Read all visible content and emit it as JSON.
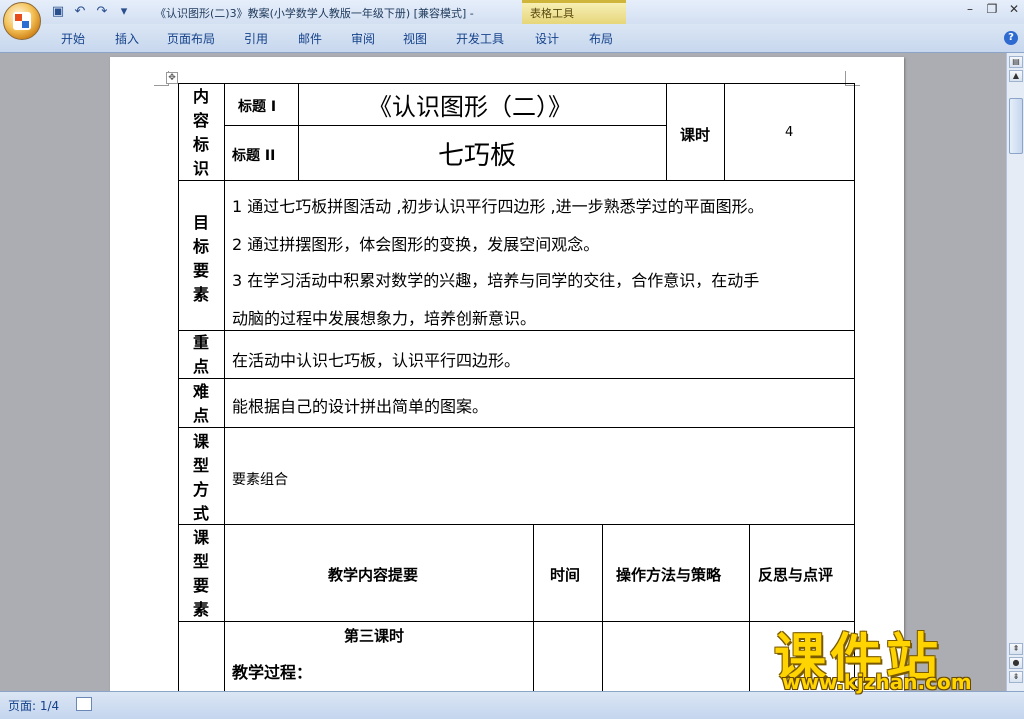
{
  "window": {
    "title": "《认识图形(二)3》教案(小学数学人教版一年级下册) [兼容模式] -",
    "context_tab_group": "表格工具",
    "min_icon": "minimize-icon",
    "restore_icon": "restore-icon",
    "close_icon": "close-icon"
  },
  "ribbon": {
    "tabs": [
      "开始",
      "插入",
      "页面布局",
      "引用",
      "邮件",
      "审阅",
      "视图",
      "开发工具",
      "设计",
      "布局"
    ]
  },
  "statusbar": {
    "page": "页面: 1/4"
  },
  "doc": {
    "row1": {
      "label": "内容标识",
      "title1_label": "标题 I",
      "title1_value": "《认识图形（二）》",
      "title2_label": "标题 II",
      "title2_value": "七巧板",
      "period_label": "课时",
      "period_value": "4"
    },
    "goals": {
      "label": "目标要素",
      "line1": "1 通过七巧板拼图活动 ,初步认识平行四边形 ,进一步熟悉学过的平面图形。",
      "line2": "2 通过拼摆图形，体会图形的变换，发展空间观念。",
      "line3": "3 在学习活动中积累对数学的兴趣，培养与同学的交往，合作意识，在动手",
      "line4": "动脑的过程中发展想象力，培养创新意识。"
    },
    "key": {
      "label": "重点",
      "text": "在活动中认识七巧板，认识平行四边形。"
    },
    "difficulty": {
      "label": "难点",
      "text": "能根据自己的设计拼出简单的图案。"
    },
    "mode": {
      "label": "课型方式",
      "text": "要素组合"
    },
    "elements": {
      "label": "课型要素",
      "col_content": "教学内容提要",
      "col_time": "时间",
      "col_method": "操作方法与策略",
      "col_reflect": "反思与点评"
    },
    "process": {
      "session": "第三课时",
      "heading": "教学过程："
    }
  },
  "watermark": {
    "brand": "课件站",
    "url": "www.kjzhan.com"
  }
}
